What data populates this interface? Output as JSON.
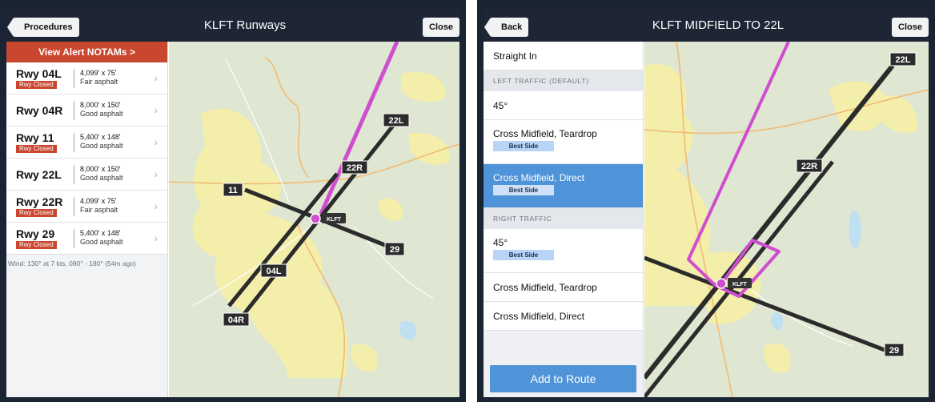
{
  "left": {
    "nav": {
      "back_label": "Procedures",
      "title": "KLFT Runways",
      "close_label": "Close"
    },
    "notam_label": "View Alert NOTAMs >",
    "runways": [
      {
        "name": "Rwy 04L",
        "badge": "Rwy Closed",
        "dims": "4,099' x 75'",
        "surface": "Fair asphalt"
      },
      {
        "name": "Rwy 04R",
        "badge": "",
        "dims": "8,000' x 150'",
        "surface": "Good asphalt"
      },
      {
        "name": "Rwy 11",
        "badge": "Rwy Closed",
        "dims": "5,400' x 148'",
        "surface": "Good asphalt"
      },
      {
        "name": "Rwy 22L",
        "badge": "",
        "dims": "8,000' x 150'",
        "surface": "Good asphalt"
      },
      {
        "name": "Rwy 22R",
        "badge": "Rwy Closed",
        "dims": "4,099' x 75'",
        "surface": "Fair asphalt"
      },
      {
        "name": "Rwy 29",
        "badge": "Rwy Closed",
        "dims": "5,400' x 148'",
        "surface": "Good asphalt"
      }
    ],
    "wind": "Wind: 130° at 7 kts, 080° - 180° (54m ago)",
    "map": {
      "airport": "KLFT",
      "labels": {
        "r22l": "22L",
        "r22r": "22R",
        "r11": "11",
        "r29": "29",
        "r04l": "04L",
        "r04r": "04R"
      }
    }
  },
  "right": {
    "nav": {
      "back_label": "Back",
      "title": "KLFT MIDFIELD TO 22L",
      "close_label": "Close"
    },
    "straight_in": "Straight In",
    "left_header": "LEFT TRAFFIC (DEFAULT)",
    "left_options": [
      {
        "label": "45°",
        "badge": ""
      },
      {
        "label": "Cross Midfield, Teardrop",
        "badge": "Best Side"
      },
      {
        "label": "Cross Midfield, Direct",
        "badge": "Best Side",
        "selected": true
      }
    ],
    "right_header": "RIGHT TRAFFIC",
    "right_options": [
      {
        "label": "45°",
        "badge": "Best Side"
      },
      {
        "label": "Cross Midfield, Teardrop",
        "badge": ""
      },
      {
        "label": "Cross Midfield, Direct",
        "badge": ""
      }
    ],
    "add_button": "Add to Route",
    "map": {
      "airport": "KLFT",
      "labels": {
        "r22l": "22L",
        "r22r": "22R",
        "r29": "29"
      }
    }
  },
  "colors": {
    "nav_bg": "#1e2636",
    "notam_red": "#c9472f",
    "selected_blue": "#4f93d8",
    "best_side_blue": "#b8d4f6",
    "route_magenta": "#d04dd0",
    "map_land": "#dfe6d2",
    "map_urban": "#f4eeab",
    "map_water": "#bfe0f0"
  }
}
